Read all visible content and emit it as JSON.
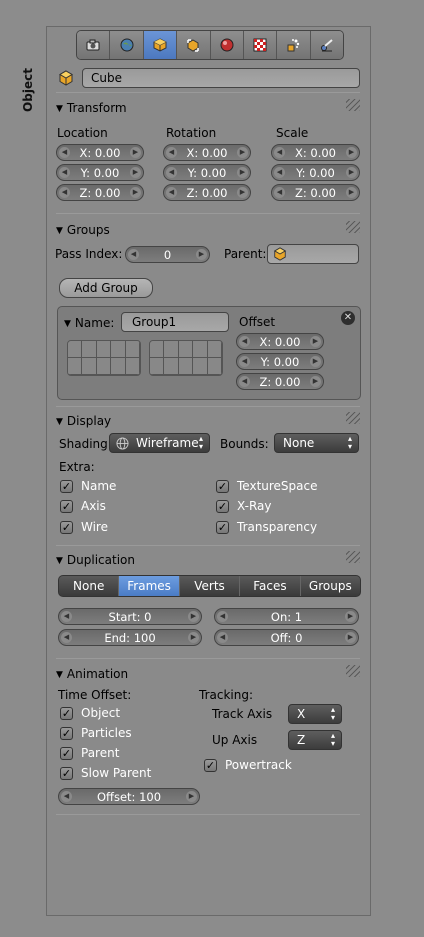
{
  "side_tab": {
    "label": "Object"
  },
  "tabs": [
    {
      "icon": "camera-icon",
      "active": false
    },
    {
      "icon": "world-icon",
      "active": false
    },
    {
      "icon": "object-cube-icon",
      "active": true
    },
    {
      "icon": "constraints-icon",
      "active": false
    },
    {
      "icon": "material-icon",
      "active": false
    },
    {
      "icon": "texture-icon",
      "active": false
    },
    {
      "icon": "particles-icon",
      "active": false
    },
    {
      "icon": "physics-icon",
      "active": false
    }
  ],
  "object_name": "Cube",
  "transform": {
    "title": "Transform",
    "location_label": "Location",
    "rotation_label": "Rotation",
    "scale_label": "Scale",
    "location": [
      "X: 0.00",
      "Y: 0.00",
      "Z: 0.00"
    ],
    "rotation": [
      "X: 0.00",
      "Y: 0.00",
      "Z: 0.00"
    ],
    "scale": [
      "X: 0.00",
      "Y: 0.00",
      "Z: 0.00"
    ]
  },
  "groups": {
    "title": "Groups",
    "pass_index_label": "Pass Index:",
    "pass_index_value": "0",
    "parent_label": "Parent:",
    "add_group_label": "Add Group",
    "name_label": "Name:",
    "group_name": "Group1",
    "offset_label": "Offset",
    "offset": [
      "X: 0.00",
      "Y: 0.00",
      "Z: 0.00"
    ]
  },
  "display": {
    "title": "Display",
    "shading_label": "Shading:",
    "shading_value": "Wireframe",
    "bounds_label": "Bounds:",
    "bounds_value": "None",
    "extra_label": "Extra:",
    "left_checks": [
      "Name",
      "Axis",
      "Wire"
    ],
    "right_checks": [
      "TextureSpace",
      "X-Ray",
      "Transparency"
    ]
  },
  "duplication": {
    "title": "Duplication",
    "modes": [
      "None",
      "Frames",
      "Verts",
      "Faces",
      "Groups"
    ],
    "active_mode": "Frames",
    "start": "Start: 0",
    "end": "End: 100",
    "on": "On: 1",
    "off": "Off: 0"
  },
  "animation": {
    "title": "Animation",
    "time_offset_label": "Time Offset:",
    "time_checks": [
      "Object",
      "Particles",
      "Parent",
      "Slow Parent"
    ],
    "offset": "Offset: 100",
    "tracking_label": "Tracking:",
    "track_axis_label": "Track Axis",
    "track_axis_value": "X",
    "up_axis_label": "Up Axis",
    "up_axis_value": "Z",
    "powertrack_label": "Powertrack"
  },
  "colors": {
    "accent": "#5a8ad2",
    "panel": "#8a8a8a",
    "background": "#8c8c8c"
  }
}
